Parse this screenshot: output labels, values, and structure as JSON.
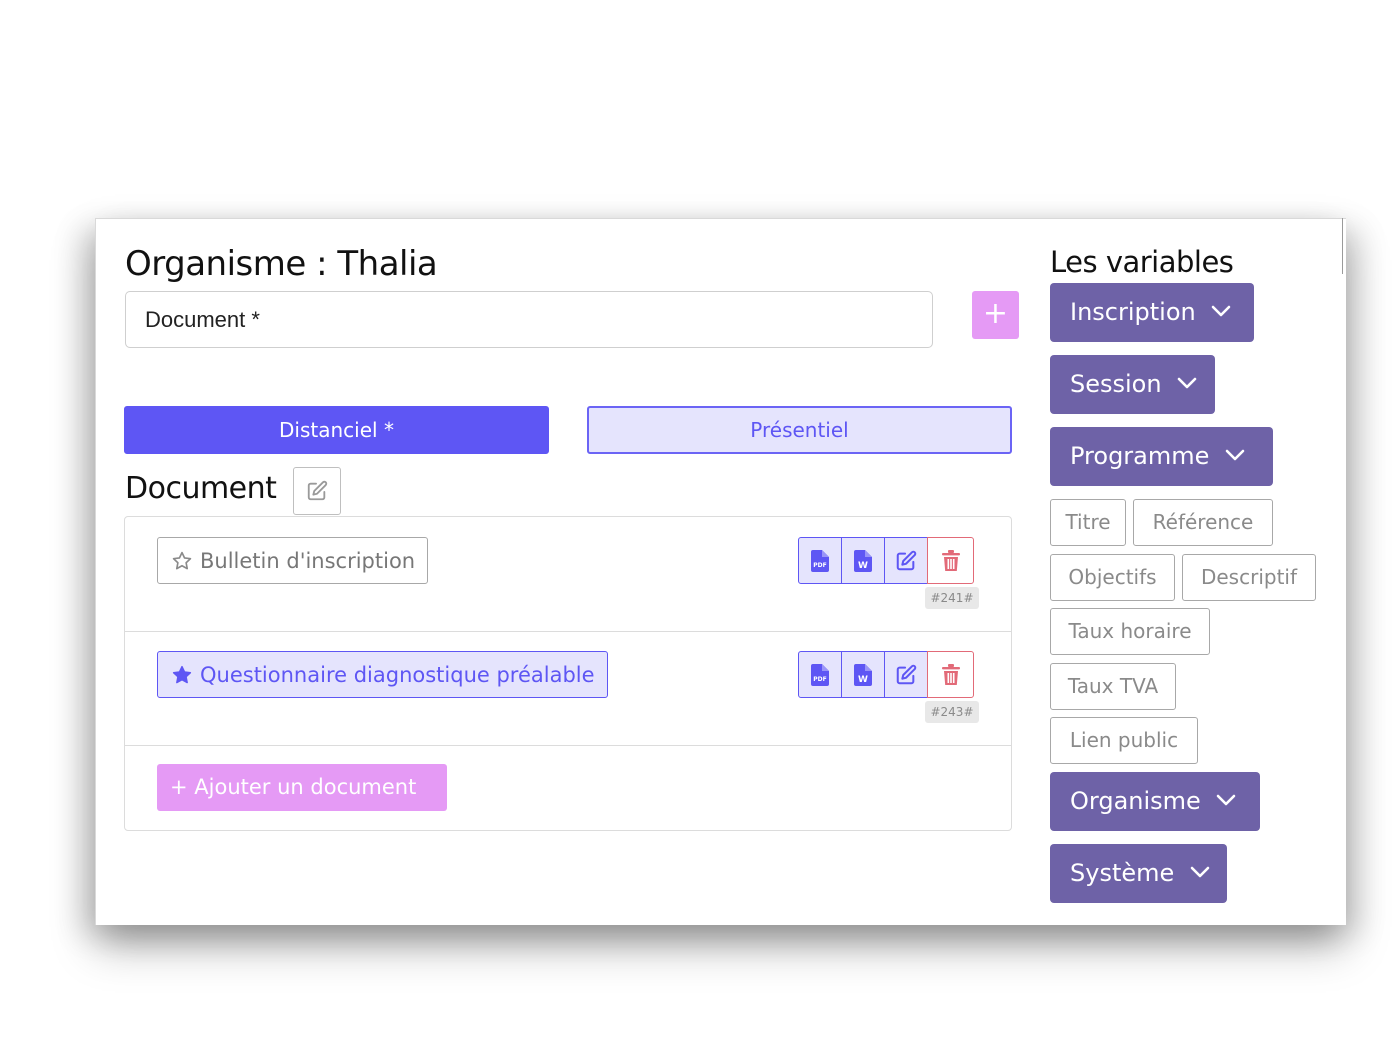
{
  "title": "Organisme : Thalia",
  "document_field": {
    "value": "Document *"
  },
  "tabs": [
    {
      "label": "Distanciel *",
      "active": true
    },
    {
      "label": "Présentiel",
      "active": false
    }
  ],
  "section_title": "Document",
  "documents": [
    {
      "label": "Bulletin d'inscription",
      "favorite": false,
      "id_tag": "#241#"
    },
    {
      "label": "Questionnaire diagnostique préalable",
      "favorite": true,
      "id_tag": "#243#"
    }
  ],
  "add_document_label": "+ Ajouter un document",
  "variables": {
    "title": "Les variables",
    "groups": {
      "inscription": "Inscription",
      "session": "Session",
      "programme": "Programme",
      "organisme": "Organisme",
      "systeme": "Système"
    },
    "programme_items": [
      "Titre",
      "Référence",
      "Objectifs",
      "Descriptif",
      "Taux horaire",
      "Taux TVA",
      "Lien public"
    ]
  },
  "colors": {
    "primary": "#5e56f4",
    "primary_light": "#e5e4fd",
    "accent_pink": "#e59af5",
    "variable_purple": "#6e62a7",
    "danger": "#e26a78"
  },
  "icons": {
    "plus": "plus-icon",
    "edit": "edit-icon",
    "star_empty": "star-outline-icon",
    "star_filled": "star-filled-icon",
    "pdf": "pdf-file-icon",
    "word": "word-file-icon",
    "trash": "trash-icon",
    "chevron": "chevron-down-icon"
  }
}
